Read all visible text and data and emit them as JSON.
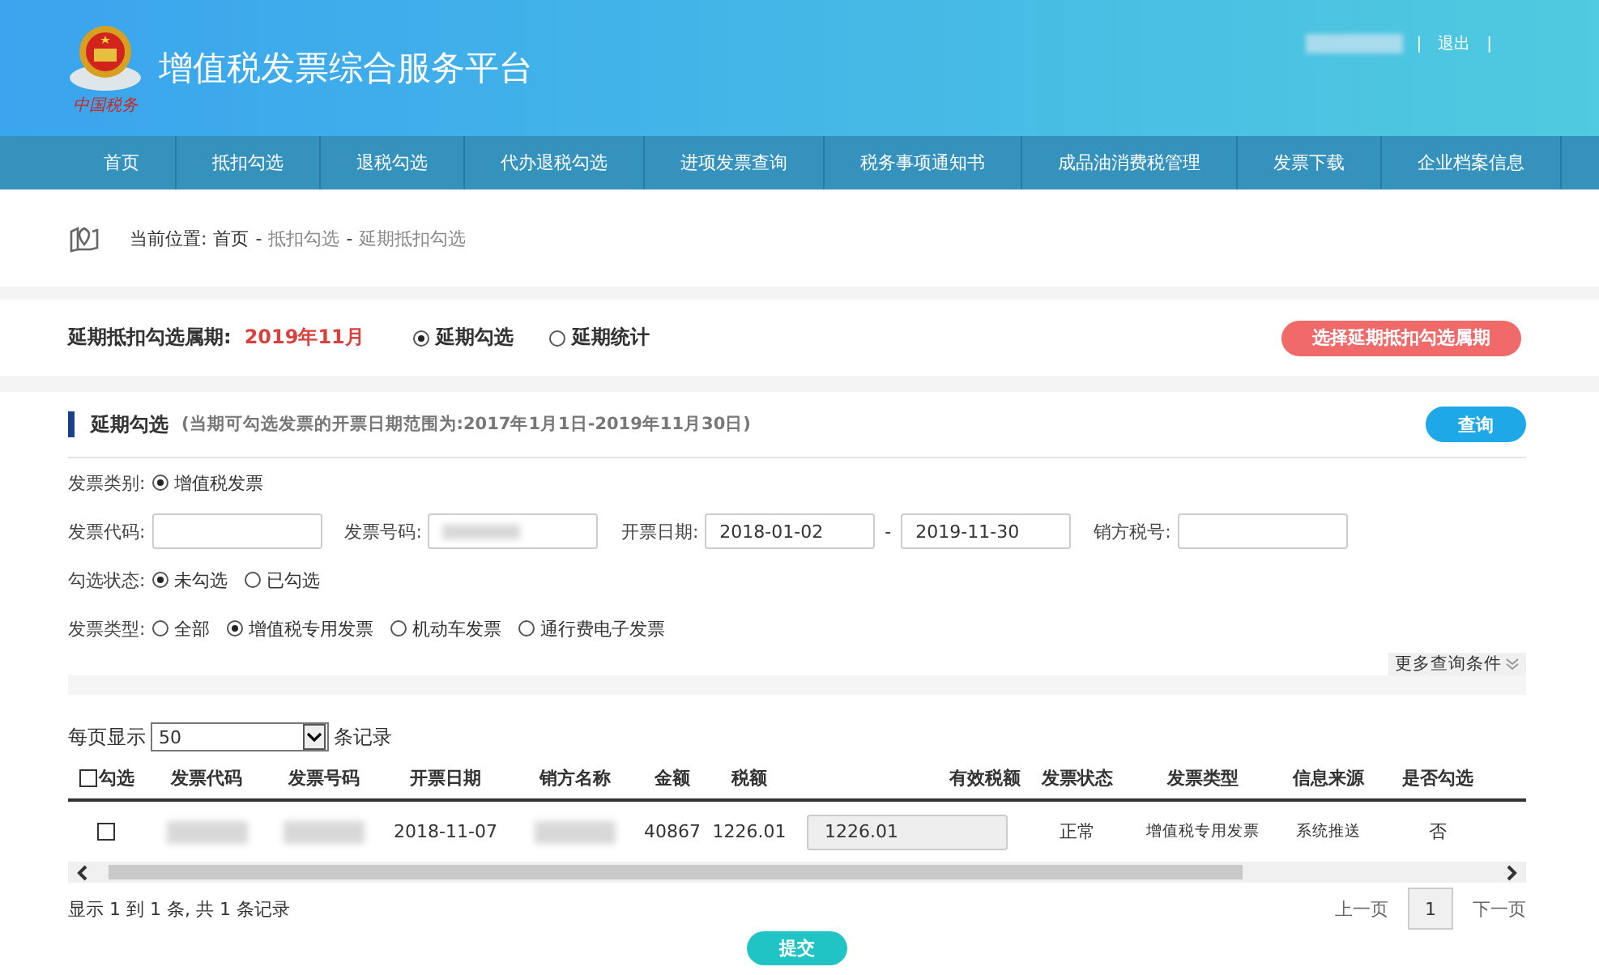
{
  "header": {
    "title": "增值税发票综合服务平台",
    "logo_text": "中国税务",
    "logout": "退出",
    "separator": "|"
  },
  "nav": [
    {
      "label": "首页",
      "selected": false
    },
    {
      "label": "抵扣勾选",
      "selected": false
    },
    {
      "label": "退税勾选",
      "selected": false
    },
    {
      "label": "代办退税勾选",
      "selected": false
    },
    {
      "label": "进项发票查询",
      "selected": false
    },
    {
      "label": "税务事项通知书",
      "selected": false
    },
    {
      "label": "成品油消费税管理",
      "selected": false
    },
    {
      "label": "发票下载",
      "selected": false
    },
    {
      "label": "企业档案信息",
      "selected": false
    }
  ],
  "breadcrumb": {
    "label": "当前位置:",
    "path": [
      "首页",
      "抵扣勾选",
      "延期抵扣勾选"
    ],
    "separator": "-"
  },
  "period": {
    "label": "延期抵扣勾选属期:",
    "value": "2019年11月",
    "options": [
      {
        "label": "延期勾选",
        "selected": true
      },
      {
        "label": "延期统计",
        "selected": false
      }
    ],
    "button": "选择延期抵扣勾选属期"
  },
  "section": {
    "title": "延期勾选",
    "note": "(当期可勾选发票的开票日期范围为:2017年1月1日-2019年11月30日)",
    "button": "查询"
  },
  "filters": {
    "category": {
      "label": "发票类别:",
      "options": [
        {
          "label": "增值税发票",
          "selected": true
        }
      ]
    },
    "code": {
      "label": "发票代码:"
    },
    "number": {
      "label": "发票号码:",
      "blurred": true
    },
    "date": {
      "label": "开票日期:",
      "from": "2018-01-02",
      "separator": "-",
      "to": "2019-11-30"
    },
    "seller_tax": {
      "label": "销方税号:"
    },
    "status": {
      "label": "勾选状态:",
      "options": [
        {
          "label": "未勾选",
          "selected": true
        },
        {
          "label": "已勾选",
          "selected": false
        }
      ]
    },
    "type": {
      "label": "发票类型:",
      "options": [
        {
          "label": "全部",
          "selected": false
        },
        {
          "label": "增值税专用发票",
          "selected": true
        },
        {
          "label": "机动车发票",
          "selected": false
        },
        {
          "label": "通行费电子发票",
          "selected": false
        }
      ]
    },
    "more": "更多查询条件"
  },
  "page_size": {
    "label": "每页显示",
    "value": "50",
    "suffix": "条记录"
  },
  "table": {
    "select_all_checked": false,
    "columns": [
      "勾选",
      "发票代码",
      "发票号码",
      "开票日期",
      "销方名称",
      "金额",
      "税额",
      "有效税额",
      "发票状态",
      "发票类型",
      "信息来源",
      "是否勾选"
    ],
    "rows": [
      {
        "cells": [
          {
            "kind": "checkbox",
            "checked": false
          },
          {
            "kind": "blurred"
          },
          {
            "kind": "blurred"
          },
          {
            "kind": "text",
            "text": "2018-11-07"
          },
          {
            "kind": "blurred"
          },
          {
            "kind": "text",
            "text": "40867"
          },
          {
            "kind": "text",
            "text": "1226.01"
          },
          {
            "kind": "input",
            "text": "1226.01"
          },
          {
            "kind": "text",
            "text": "正常"
          },
          {
            "kind": "text",
            "text": "增值税专用发票"
          },
          {
            "kind": "text",
            "text": "系统推送"
          },
          {
            "kind": "text",
            "text": "否"
          }
        ]
      }
    ]
  },
  "summary": "显示 1 到 1 条, 共 1 条记录",
  "pager": {
    "prev": "上一页",
    "pages": [
      {
        "label": "1",
        "selected": true
      }
    ],
    "next": "下一页"
  },
  "submit": "提交"
}
